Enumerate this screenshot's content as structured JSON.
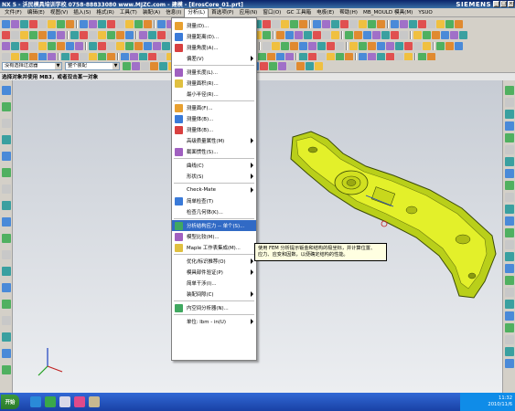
{
  "window": {
    "title": "NX 5 - 沃民模具培训学校 0758-88833080  www.MJZC.com - 建模 - [ErosCore_01.prt]",
    "brand": "SIEMENS"
  },
  "menubar": {
    "items": [
      "文件(F)",
      "编辑(E)",
      "视图(V)",
      "插入(S)",
      "格式(R)",
      "工具(T)",
      "装配(A)",
      "信息(I)",
      "分析(L)",
      "首选项(P)",
      "应用(N)",
      "窗口(O)",
      "GC 工具箱",
      "电极(E)",
      "帮助(H)",
      "MB_MOULD 模具(M)",
      "YSUO"
    ],
    "active_index": 8
  },
  "filter": {
    "selection_filter": "没有选择过滤器",
    "assembly_scope": "整个装配"
  },
  "cue_line": "选择对象并使用 MB3，或者双击某一对象",
  "analysis_menu": {
    "items": [
      {
        "label": "测量(D)...",
        "icon": "measure-distance-icon",
        "submenu": false
      },
      {
        "label": "测量距离(D)...",
        "icon": "measure-distance-icon",
        "submenu": false
      },
      {
        "label": "测量角度(A)...",
        "icon": "measure-angle-icon",
        "submenu": false
      },
      {
        "label": "偏差(V)",
        "icon": "",
        "submenu": true
      },
      {
        "label": "测量长度(L)...",
        "icon": "measure-length-icon",
        "submenu": false
      },
      {
        "label": "测量面积(R)...",
        "icon": "measure-area-icon",
        "submenu": false
      },
      {
        "label": "最小半径(R)...",
        "icon": "",
        "submenu": false
      },
      {
        "label": "测量面(F)...",
        "icon": "measure-face-icon",
        "submenu": false
      },
      {
        "label": "测量体(B)...",
        "icon": "measure-body-icon",
        "submenu": false
      },
      {
        "label": "测量体(B)...",
        "icon": "measure-body-icon",
        "submenu": false
      },
      {
        "label": "高级质量属性(M)",
        "icon": "",
        "submenu": true
      },
      {
        "label": "截面惯性(S)...",
        "icon": "section-inertia-icon",
        "submenu": false
      },
      {
        "label": "曲线(C)",
        "icon": "",
        "submenu": true
      },
      {
        "label": "形状(S)",
        "icon": "",
        "submenu": true
      },
      {
        "label": "Check-Mate",
        "icon": "",
        "submenu": true
      },
      {
        "label": "简单检查(T)",
        "icon": "simple-check-icon",
        "submenu": false
      },
      {
        "label": "检查几何体(K)...",
        "icon": "",
        "submenu": false
      },
      {
        "label": "分析结构应力 -- 单个(S)...",
        "icon": "stress-analysis-icon",
        "submenu": false,
        "highlighted": true
      },
      {
        "label": "模型比较(M)...",
        "icon": "model-compare-icon",
        "submenu": false
      },
      {
        "label": "Maple 工作表集成(M)...",
        "icon": "maple-icon",
        "submenu": false
      },
      {
        "label": "优化/标识推荐(O)",
        "icon": "",
        "submenu": true
      },
      {
        "label": "模具部件验证(P)",
        "icon": "",
        "submenu": true
      },
      {
        "label": "简单干涉(I)...",
        "icon": "",
        "submenu": false
      },
      {
        "label": "装配间隙(C)",
        "icon": "",
        "submenu": true
      },
      {
        "label": "内空间分析器(N)...",
        "icon": "space-analyzer-icon",
        "submenu": false
      },
      {
        "label": "单位: lbm - in(U)",
        "icon": "",
        "submenu": true
      }
    ]
  },
  "tooltip": {
    "line1": "使用 FEM 分析提示钣金和结构的极坐标，并计算位置、",
    "line2": "应力、应变和因数，以便确定结构的性能。"
  },
  "taskbar": {
    "start_label": "开始",
    "time": "11:32",
    "date": "2010/11/6"
  }
}
